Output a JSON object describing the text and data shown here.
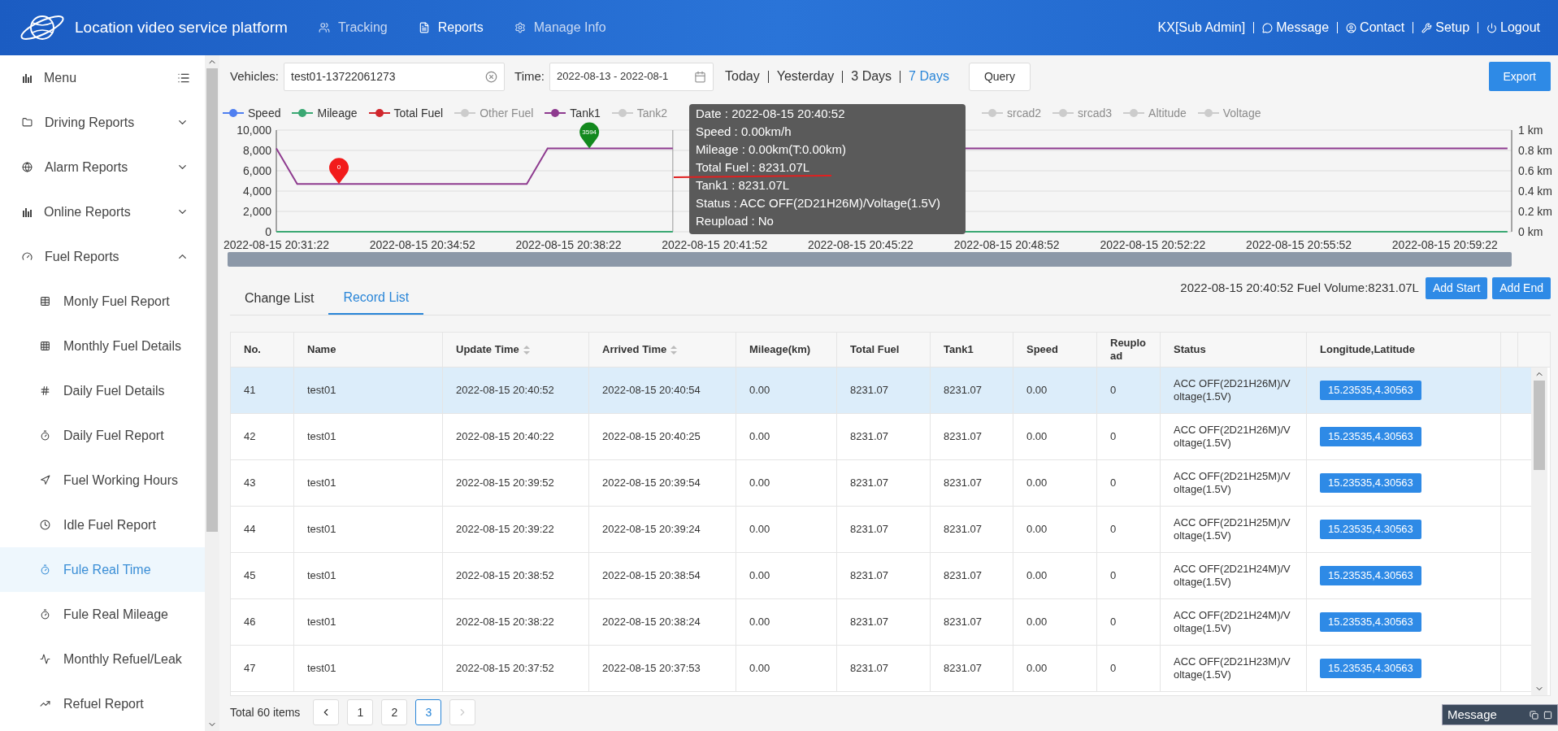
{
  "header": {
    "title": "Location video service platform",
    "nav": [
      {
        "label": "Tracking",
        "selected": false
      },
      {
        "label": "Reports",
        "selected": true
      },
      {
        "label": "Manage Info",
        "selected": false
      }
    ],
    "user": "KX[Sub Admin]",
    "links": [
      "Message",
      "Contact",
      "Setup",
      "Logout"
    ]
  },
  "sidebar": {
    "title": "Menu",
    "groups": [
      {
        "label": "Driving Reports",
        "expanded": false
      },
      {
        "label": "Alarm Reports",
        "expanded": false
      },
      {
        "label": "Online Reports",
        "expanded": false
      },
      {
        "label": "Fuel Reports",
        "expanded": true,
        "children": [
          {
            "label": "Monly Fuel Report",
            "selected": false
          },
          {
            "label": "Monthly Fuel Details",
            "selected": false
          },
          {
            "label": "Daily Fuel Details",
            "selected": false
          },
          {
            "label": "Daily Fuel Report",
            "selected": false
          },
          {
            "label": "Fuel Working Hours",
            "selected": false
          },
          {
            "label": "Idle Fuel Report",
            "selected": false
          },
          {
            "label": "Fule Real Time",
            "selected": true
          },
          {
            "label": "Fule Real Mileage",
            "selected": false
          },
          {
            "label": "Monthly Refuel/Leak",
            "selected": false
          },
          {
            "label": "Refuel Report",
            "selected": false
          }
        ]
      }
    ]
  },
  "filters": {
    "vehicles_label": "Vehicles:",
    "vehicle": "test01-13722061273",
    "time_label": "Time:",
    "time": "2022-08-13 - 2022-08-1",
    "ranges": [
      {
        "label": "Today",
        "selected": false
      },
      {
        "label": "Yesterday",
        "selected": false
      },
      {
        "label": "3 Days",
        "selected": false
      },
      {
        "label": "7 Days",
        "selected": true
      }
    ],
    "query": "Query",
    "export": "Export"
  },
  "chart": {
    "legend": [
      {
        "label": "Speed",
        "on": true,
        "color": "#4f7ff0"
      },
      {
        "kind": "series",
        "on": true
      },
      {
        "label": "Total Fuel",
        "on": true,
        "color": "#d0262c"
      },
      {
        "label": "Other Fuel",
        "on": false
      },
      {
        "kind": "series",
        "on": true
      },
      {
        "label": "Tank2",
        "on": false
      }
    ],
    "legend_right": [
      {
        "label": "srcad2",
        "on": false
      },
      {
        "label": "srcad3",
        "on": false
      },
      {
        "label": "Altitude",
        "on": false
      },
      {
        "label": "Voltage",
        "on": false
      }
    ],
    "right_axis": [
      "1 km",
      "0.8 km",
      "0.6 km",
      "0.4 km",
      "0.2 km",
      "0 km"
    ],
    "chart_data": {
      "type": "line",
      "categories": [
        "2022-08-15 20:31:22",
        null,
        null,
        null,
        null,
        null,
        null,
        "2022-08-15 20:34:52",
        null,
        null,
        null,
        null,
        null,
        null,
        "2022-08-15 20:38:22",
        null,
        null,
        null,
        null,
        null,
        null,
        "2022-08-15 20:41:52",
        null,
        null,
        null,
        null,
        null,
        null,
        "2022-08-15 20:45:22",
        null,
        null,
        null,
        null,
        null,
        null,
        "2022-08-15 20:48:52",
        null,
        null,
        null,
        null,
        null,
        null,
        "2022-08-15 20:52:22",
        null,
        null,
        null,
        null,
        null,
        null,
        "2022-08-15 20:55:52",
        null,
        null,
        null,
        null,
        null,
        null,
        "2022-08-15 20:59:22",
        null,
        null,
        null
      ],
      "series": [
        {
          "name": "Mileage",
          "color": "#3aa873",
          "values": [
            0,
            0,
            0,
            0,
            0,
            0,
            0,
            0,
            0,
            0,
            0,
            0,
            0,
            0,
            0,
            0,
            0,
            0,
            0,
            0,
            null,
            null,
            null,
            null,
            null,
            null,
            null,
            null,
            null,
            null,
            null,
            null,
            null,
            0,
            0,
            0,
            0,
            0,
            0,
            0,
            0,
            0,
            0,
            0,
            0,
            0,
            0,
            0,
            0,
            0,
            0,
            0,
            0,
            0,
            0,
            0,
            0,
            0,
            0,
            0
          ]
        },
        {
          "name": "Tank1",
          "color": "#8e3b8f",
          "values": [
            8200,
            4700,
            4700,
            4700,
            4700,
            4700,
            4700,
            4700,
            4700,
            4700,
            4700,
            4700,
            4700,
            8200,
            8200,
            8200,
            8200,
            8200,
            8200,
            8200,
            null,
            null,
            null,
            null,
            null,
            null,
            null,
            null,
            null,
            null,
            null,
            null,
            null,
            8200,
            8200,
            8200,
            8200,
            8200,
            8200,
            8200,
            8200,
            8200,
            8200,
            8200,
            8200,
            8200,
            8200,
            8200,
            8200,
            8200,
            8200,
            8200,
            8200,
            8200,
            8200,
            8200,
            8200,
            8200,
            8200,
            8200
          ]
        }
      ],
      "ylim": [
        0,
        10000
      ],
      "grid": true,
      "yticks": [
        {
          "value": 0,
          "label": "0"
        },
        {
          "value": 2000,
          "label": "2,000"
        },
        {
          "value": 4000,
          "label": "4,000"
        },
        {
          "value": 6000,
          "label": "6,000"
        },
        {
          "value": 8000,
          "label": "8,000"
        },
        {
          "value": 10000,
          "label": "10,000"
        }
      ],
      "annotations": [
        {
          "y": 4700,
          "text": "0"
        },
        {
          "y": 8200,
          "text": "3594"
        }
      ]
    },
    "tooltip": [
      "Date : 2022-08-15 20:40:52",
      "Speed : 0.00km/h",
      "Mileage : 0.00km(T:0.00km)",
      "Total Fuel : 8231.07L",
      "Tank1 : 8231.07L",
      "Status : ACC OFF(2D21H26M)/Voltage(1.5V)",
      "Reupload : No"
    ]
  },
  "tabs": [
    {
      "label": "Change List",
      "selected": false
    },
    {
      "label": "Record List",
      "selected": true
    }
  ],
  "point_info": "2022-08-15 20:40:52 Fuel Volume:8231.07L",
  "point_buttons": [
    "Add Start",
    "Add End"
  ],
  "table": {
    "columns": [
      {
        "label": "No.",
        "sortable": false
      },
      {
        "label": "Name",
        "sortable": false
      },
      {
        "label": "Update Time",
        "sortable": true
      },
      {
        "label": "Arrived Time",
        "sortable": true
      },
      {
        "label": "Mileage(km)",
        "sortable": false
      },
      {
        "label": "Total Fuel",
        "sortable": false
      },
      {
        "label": "Tank1",
        "sortable": false
      },
      {
        "label": "Speed",
        "sortable": false
      },
      {
        "label": "Reupload",
        "sortable": false
      },
      {
        "label": "Status",
        "sortable": false
      },
      {
        "label": "Longitude,Latitude",
        "sortable": false
      }
    ],
    "rows": [
      {
        "selected": true,
        "cells": [
          "41",
          "test01",
          "2022-08-15 20:40:52",
          "2022-08-15 20:40:54",
          "0.00",
          "8231.07",
          "8231.07",
          "0.00",
          "0",
          "ACC OFF(2D21H26M)/Voltage(1.5V)",
          "15.23535,4.30563"
        ]
      },
      {
        "selected": false,
        "cells": [
          "42",
          "test01",
          "2022-08-15 20:40:22",
          "2022-08-15 20:40:25",
          "0.00",
          "8231.07",
          "8231.07",
          "0.00",
          "0",
          "ACC OFF(2D21H26M)/Voltage(1.5V)",
          "15.23535,4.30563"
        ]
      },
      {
        "selected": false,
        "cells": [
          "43",
          "test01",
          "2022-08-15 20:39:52",
          "2022-08-15 20:39:54",
          "0.00",
          "8231.07",
          "8231.07",
          "0.00",
          "0",
          "ACC OFF(2D21H25M)/Voltage(1.5V)",
          "15.23535,4.30563"
        ]
      },
      {
        "selected": false,
        "cells": [
          "44",
          "test01",
          "2022-08-15 20:39:22",
          "2022-08-15 20:39:24",
          "0.00",
          "8231.07",
          "8231.07",
          "0.00",
          "0",
          "ACC OFF(2D21H25M)/Voltage(1.5V)",
          "15.23535,4.30563"
        ]
      },
      {
        "selected": false,
        "cells": [
          "45",
          "test01",
          "2022-08-15 20:38:52",
          "2022-08-15 20:38:54",
          "0.00",
          "8231.07",
          "8231.07",
          "0.00",
          "0",
          "ACC OFF(2D21H24M)/Voltage(1.5V)",
          "15.23535,4.30563"
        ]
      },
      {
        "selected": false,
        "cells": [
          "46",
          "test01",
          "2022-08-15 20:38:22",
          "2022-08-15 20:38:24",
          "0.00",
          "8231.07",
          "8231.07",
          "0.00",
          "0",
          "ACC OFF(2D21H24M)/Voltage(1.5V)",
          "15.23535,4.30563"
        ]
      },
      {
        "selected": false,
        "cells": [
          "47",
          "test01",
          "2022-08-15 20:37:52",
          "2022-08-15 20:37:53",
          "0.00",
          "8231.07",
          "8231.07",
          "0.00",
          "0",
          "ACC OFF(2D21H23M)/Voltage(1.5V)",
          "15.23535,4.30563"
        ]
      }
    ]
  },
  "pagination": {
    "total": "Total 60 items",
    "pages": [
      {
        "label": "1",
        "selected": false
      },
      {
        "label": "2",
        "selected": false
      },
      {
        "label": "3",
        "selected": true
      }
    ],
    "next_disabled": true
  },
  "message_box": {
    "title": "Message"
  }
}
